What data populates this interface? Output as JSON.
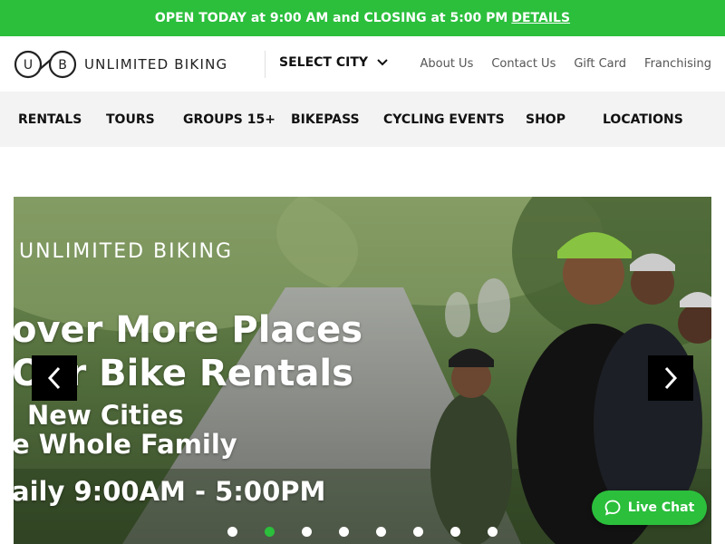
{
  "announcement": {
    "text": "OPEN TODAY at 9:00 AM and CLOSING at 5:00 PM",
    "link": "DETAILS"
  },
  "header": {
    "logo_mark": "U B",
    "logo_text": "UNLIMITED BIKING",
    "select_city": "SELECT CITY",
    "utility_links": [
      "About Us",
      "Contact Us",
      "Gift Card",
      "Franchising"
    ]
  },
  "nav": {
    "items": [
      "RENTALS",
      "TOURS",
      "GROUPS 15+",
      "BIKEPASS",
      "CYCLING EVENTS",
      "SHOP",
      "LOCATIONS"
    ]
  },
  "hero": {
    "brand": "UNLIMITED BIKING",
    "line1": "over More Places",
    "line2": "Our Bike Rentals",
    "line3": "New Cities",
    "line4": "e Whole Family",
    "line5": "aily 9:00AM - 5:00PM",
    "slide_count": 8,
    "active_slide": 2
  },
  "chat": {
    "label": "Live Chat"
  },
  "colors": {
    "brand_green": "#2bbf3c"
  },
  "icons": [
    "chevron-down-icon",
    "chevron-left-icon",
    "chevron-right-icon",
    "chat-bubble-icon"
  ]
}
